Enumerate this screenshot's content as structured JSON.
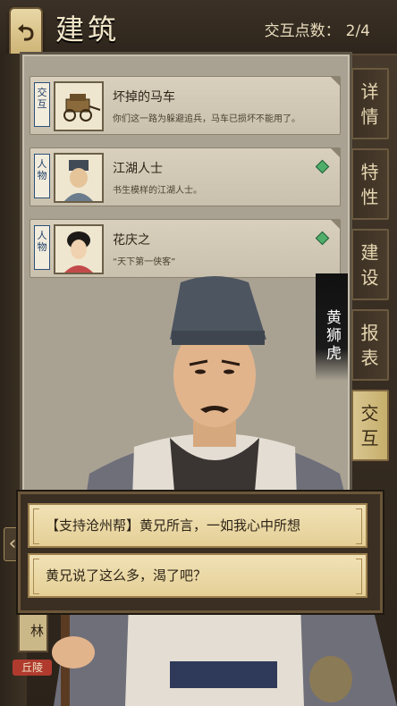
{
  "header": {
    "title": "建筑",
    "points_label": "交互点数：",
    "points_value": "2/4"
  },
  "cards": [
    {
      "type": "交互",
      "title": "坏掉的马车",
      "desc": "你们这一路为躲避追兵，马车已损坏不能用了。",
      "gem": false
    },
    {
      "type": "人物",
      "title": "江湖人士",
      "desc": "书生模样的江湖人士。",
      "gem": true
    },
    {
      "type": "人物",
      "title": "花庆之",
      "desc": "“天下第一侠客”",
      "gem": true
    }
  ],
  "tabs": [
    {
      "label": "详情",
      "active": false
    },
    {
      "label": "特性",
      "active": false
    },
    {
      "label": "建设",
      "active": false
    },
    {
      "label": "报表",
      "active": false
    },
    {
      "label": "交互",
      "active": true
    }
  ],
  "speaker": {
    "name": "黄狮虎"
  },
  "dialog": {
    "options": [
      "【支持沧州帮】黄兄所言，一如我心中所想",
      "黄兄说了这么多，渴了吧？"
    ]
  },
  "side": {
    "lin_label": "林",
    "qiu_label": "丘陵"
  },
  "colors": {
    "accent": "#d9c690",
    "gem": "#4fae6a",
    "badge": "#b03a2e"
  }
}
